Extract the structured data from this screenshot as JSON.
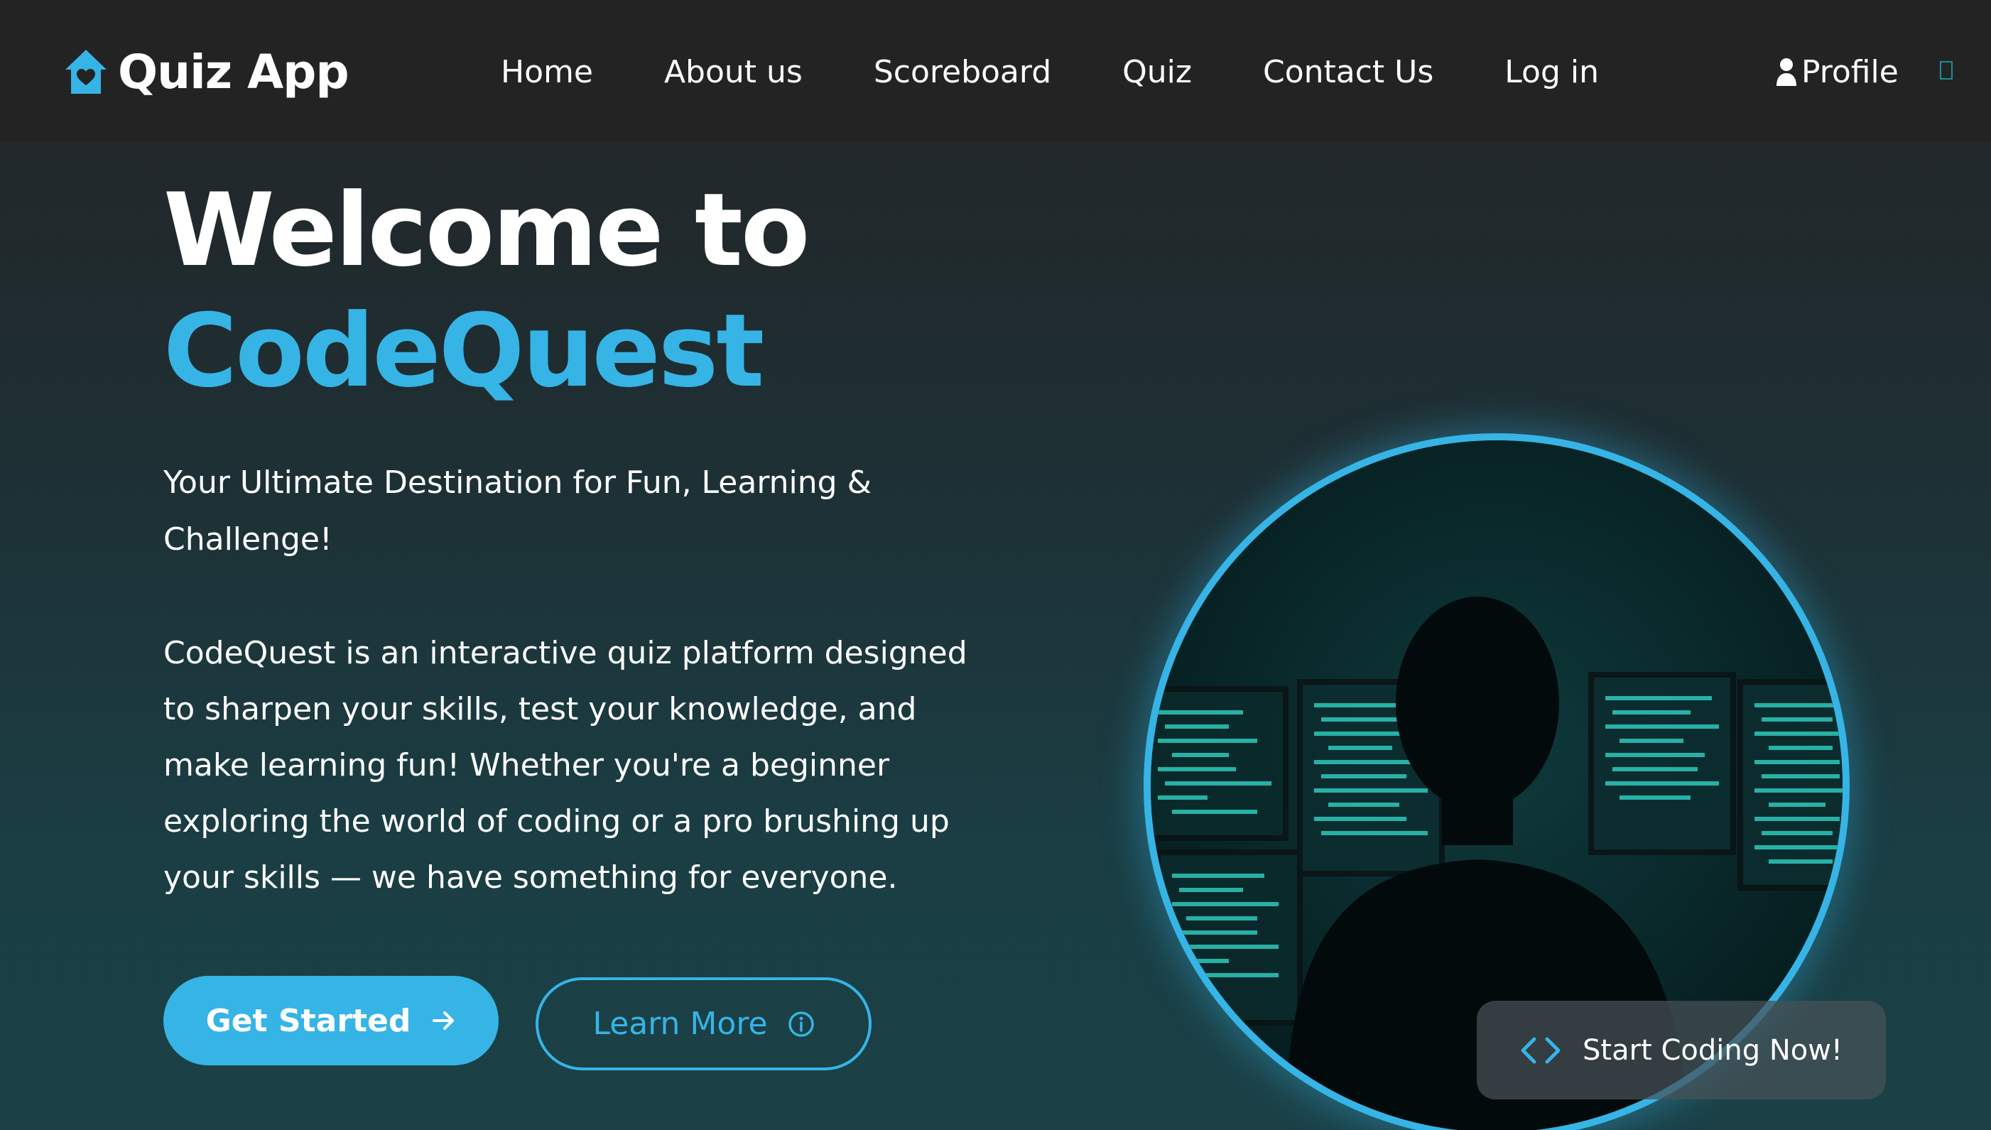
{
  "navbar": {
    "brand": "Quiz App",
    "links": [
      "Home",
      "About us",
      "Scoreboard",
      "Quiz",
      "Contact Us",
      "Log in"
    ],
    "profile_label": "Profile",
    "brand_icon": "home-heart-icon",
    "profile_icon": "person-icon"
  },
  "hero": {
    "title_line1": "Welcome to",
    "title_line2": "CodeQuest",
    "tagline": "Your Ultimate Destination for Fun, Learning & Challenge!",
    "description": "CodeQuest is an interactive quiz platform designed to sharpen your skills, test your knowledge, and make learning fun! Whether you're a beginner exploring the world of coding or a pro brushing up your skills — we have something for everyone.",
    "primary_button": "Get Started",
    "secondary_button": "Learn More",
    "badge_label": "Start Coding Now!"
  },
  "colors": {
    "accent": "#36b4e6",
    "navbar_bg": "#232323",
    "text": "#ffffff"
  }
}
